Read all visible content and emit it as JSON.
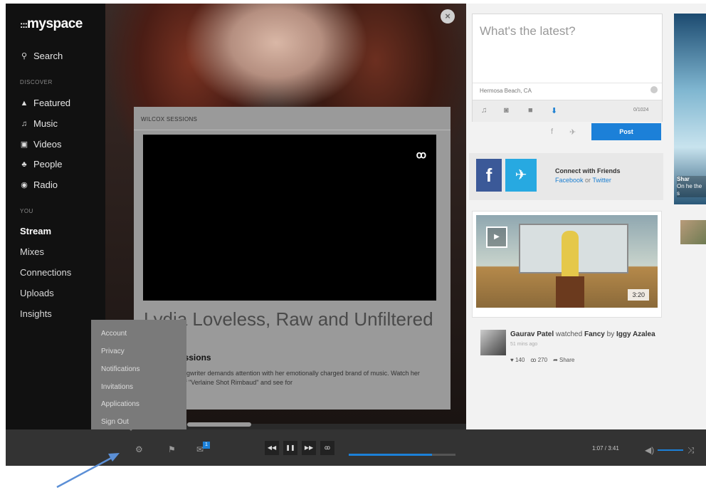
{
  "sidebar": {
    "logo": "myspace",
    "logo_dots": ":::",
    "search_label": "Search",
    "discover_heading": "DISCOVER",
    "discover_items": [
      {
        "label": "Featured",
        "icon": "flame-icon",
        "glyph": "▲"
      },
      {
        "label": "Music",
        "icon": "music-note-icon",
        "glyph": "♫"
      },
      {
        "label": "Videos",
        "icon": "video-icon",
        "glyph": "▣"
      },
      {
        "label": "People",
        "icon": "people-icon",
        "glyph": "♣"
      },
      {
        "label": "Radio",
        "icon": "radio-icon",
        "glyph": "◉"
      }
    ],
    "you_heading": "YOU",
    "you_items": [
      "Stream",
      "Mixes",
      "Connections",
      "Uploads",
      "Insights"
    ]
  },
  "panel": {
    "heading": "WILCOX SESSIONS",
    "title": "Lydia Loveless, Raw and Unfiltered",
    "subtitle": "Wilcox Sessions",
    "description": "The singer-songwriter demands attention with her emotionally charged brand of music. Watch her performance of \"Verlaine Shot Rimbaud\" and see for"
  },
  "settings_menu": {
    "items": [
      "Account",
      "Privacy",
      "Notifications",
      "Invitations",
      "Applications",
      "Sign Out"
    ]
  },
  "compose": {
    "placeholder": "What's the latest?",
    "location": "Hermosa Beach, CA",
    "char_count": "0/1024",
    "post_label": "Post"
  },
  "connect": {
    "title": "Connect with Friends",
    "facebook": "Facebook",
    "or": " or ",
    "twitter": "Twitter"
  },
  "video_card": {
    "duration": "3:20"
  },
  "activity": {
    "user": "Gaurav Patel",
    "action": " watched ",
    "item": "Fancy",
    "by": " by ",
    "artist": "Iggy Azalea",
    "time": "51 mins ago",
    "likes": "140",
    "plays": "270",
    "share": "Share"
  },
  "side_card": {
    "title": "Shar",
    "text": "On he the s"
  },
  "player": {
    "notification_count": "1",
    "time": "1:07 / 3:41",
    "progress": 0.78
  }
}
